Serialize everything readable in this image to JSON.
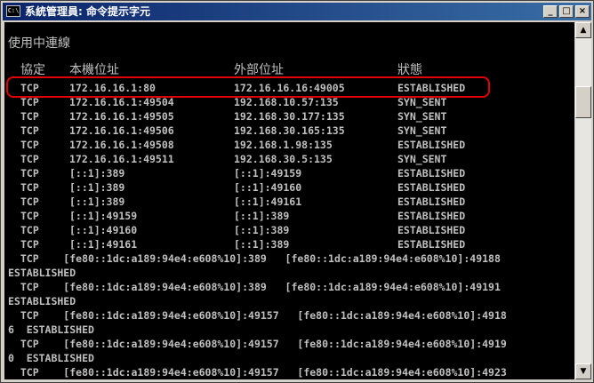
{
  "window": {
    "title": "系統管理員: 命令提示字元",
    "icon": "console-icon",
    "icon_text": "C:\\",
    "minimize": "_",
    "maximize": "□",
    "close": "×"
  },
  "console": {
    "section_title": "使用中連線",
    "headers": [
      "協定",
      "本機位址",
      "外部位址",
      "狀態"
    ],
    "rows": [
      [
        "TCP",
        "172.16.16.1:80",
        "172.16.16.16:49005",
        "ESTABLISHED"
      ],
      [
        "TCP",
        "172.16.16.1:49504",
        "192.168.10.57:135",
        "SYN_SENT"
      ],
      [
        "TCP",
        "172.16.16.1:49505",
        "192.168.30.177:135",
        "SYN_SENT"
      ],
      [
        "TCP",
        "172.16.16.1:49506",
        "192.168.30.165:135",
        "SYN_SENT"
      ],
      [
        "TCP",
        "172.16.16.1:49508",
        "192.168.1.98:135",
        "ESTABLISHED"
      ],
      [
        "TCP",
        "172.16.16.1:49511",
        "192.168.30.5:135",
        "SYN_SENT"
      ],
      [
        "TCP",
        "[::1]:389",
        "[::1]:49159",
        "ESTABLISHED"
      ],
      [
        "TCP",
        "[::1]:389",
        "[::1]:49160",
        "ESTABLISHED"
      ],
      [
        "TCP",
        "[::1]:389",
        "[::1]:49161",
        "ESTABLISHED"
      ],
      [
        "TCP",
        "[::1]:49159",
        "[::1]:389",
        "ESTABLISHED"
      ],
      [
        "TCP",
        "[::1]:49160",
        "[::1]:389",
        "ESTABLISHED"
      ],
      [
        "TCP",
        "[::1]:49161",
        "[::1]:389",
        "ESTABLISHED"
      ]
    ],
    "wrapped_lines": [
      "  TCP    [fe80::1dc:a189:94e4:e608%10]:389   [fe80::1dc:a189:94e4:e608%10]:49188",
      "ESTABLISHED",
      "  TCP    [fe80::1dc:a189:94e4:e608%10]:389   [fe80::1dc:a189:94e4:e608%10]:49191",
      "ESTABLISHED",
      "  TCP    [fe80::1dc:a189:94e4:e608%10]:49157   [fe80::1dc:a189:94e4:e608%10]:4918",
      "6  ESTABLISHED",
      "  TCP    [fe80::1dc:a189:94e4:e608%10]:49157   [fe80::1dc:a189:94e4:e608%10]:4919",
      "0  ESTABLISHED",
      "  TCP    [fe80::1dc:a189:94e4:e608%10]:49157   [fe80::1dc:a189:94e4:e608%10]:4923"
    ],
    "highlight_color": "#e00000",
    "text_color": "#c0c0c0",
    "background": "#000000"
  },
  "scrollbar": {
    "up_arrow": "▲",
    "down_arrow": "▼"
  }
}
